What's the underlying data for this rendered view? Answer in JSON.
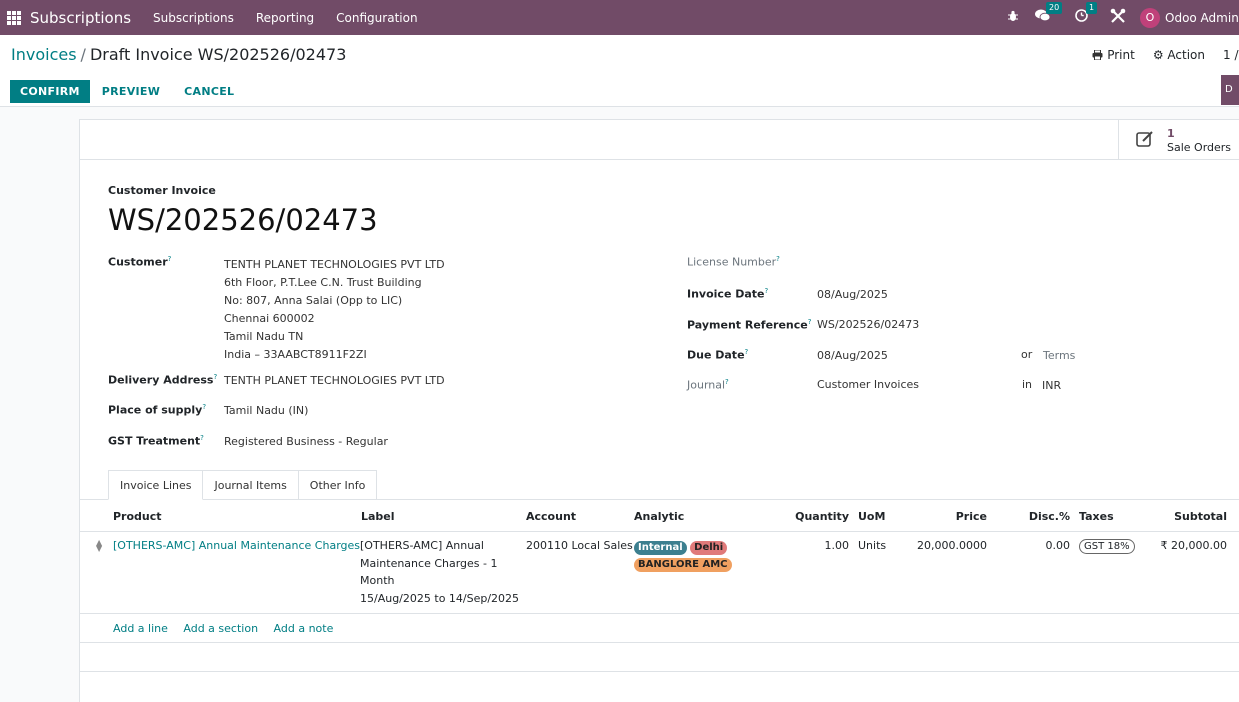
{
  "navbar": {
    "app_name": "Subscriptions",
    "menus": [
      "Subscriptions",
      "Reporting",
      "Configuration"
    ],
    "messages_count": "20",
    "activities_count": "1",
    "avatar_letter": "O",
    "user_name": "Odoo Admin (",
    "color": "#714b67"
  },
  "breadcrumb": {
    "parent": "Invoices",
    "separator": "/",
    "current": "Draft Invoice WS/202526/02473"
  },
  "control": {
    "print_label": "Print",
    "action_label": "Action",
    "pager": "1 /",
    "confirm_label": "CONFIRM",
    "preview_label": "PREVIEW",
    "cancel_label": "CANCEL",
    "status_stub": "D",
    "accent": "#017e84"
  },
  "smart_button": {
    "count": "1",
    "label": "Sale Orders"
  },
  "invoice": {
    "type_label": "Customer Invoice",
    "name": "WS/202526/02473"
  },
  "left_fields": {
    "customer_label": "Customer",
    "customer_lines": [
      "TENTH PLANET TECHNOLOGIES PVT LTD",
      "6th Floor, P.T.Lee C.N. Trust Building",
      "No: 807, Anna Salai (Opp to LIC)",
      "Chennai 600002",
      "Tamil Nadu TN",
      "India – 33AABCT8911F2ZI"
    ],
    "delivery_label": "Delivery Address",
    "delivery_value": "TENTH PLANET TECHNOLOGIES PVT LTD",
    "supply_label": "Place of supply",
    "supply_value": "Tamil Nadu (IN)",
    "gst_label": "GST Treatment",
    "gst_value": "Registered Business - Regular"
  },
  "right_fields": {
    "license_label": "License Number",
    "invoice_date_label": "Invoice Date",
    "invoice_date_value": "08/Aug/2025",
    "payment_ref_label": "Payment Reference",
    "payment_ref_value": "WS/202526/02473",
    "due_date_label": "Due Date",
    "due_date_value": "08/Aug/2025",
    "or_text": "or",
    "terms_placeholder": "Terms",
    "journal_label": "Journal",
    "journal_value": "Customer Invoices",
    "in_text": "in",
    "currency": "INR"
  },
  "tabs": [
    "Invoice Lines",
    "Journal Items",
    "Other Info"
  ],
  "table": {
    "headers": {
      "product": "Product",
      "label": "Label",
      "account": "Account",
      "analytic": "Analytic",
      "quantity": "Quantity",
      "uom": "UoM",
      "price": "Price",
      "disc": "Disc.%",
      "taxes": "Taxes",
      "subtotal": "Subtotal"
    },
    "rows": [
      {
        "product": "[OTHERS-AMC] Annual Maintenance Charges",
        "label_lines": [
          "[OTHERS-AMC] Annual",
          "Maintenance Charges - 1",
          "Month",
          "15/Aug/2025 to 14/Sep/2025"
        ],
        "account": "200110 Local Sales",
        "analytic_tags": [
          {
            "name": "Internal",
            "color": "#3c7f8f"
          },
          {
            "name": "Delhi",
            "color": "#e07a7a"
          },
          {
            "name": "BANGLORE AMC",
            "color": "#f0a060"
          }
        ],
        "quantity": "1.00",
        "uom": "Units",
        "price": "20,000.0000",
        "disc": "0.00",
        "tax": "GST 18%",
        "subtotal": "₹ 20,000.00"
      }
    ],
    "add_links": [
      "Add a line",
      "Add a section",
      "Add a note"
    ]
  }
}
